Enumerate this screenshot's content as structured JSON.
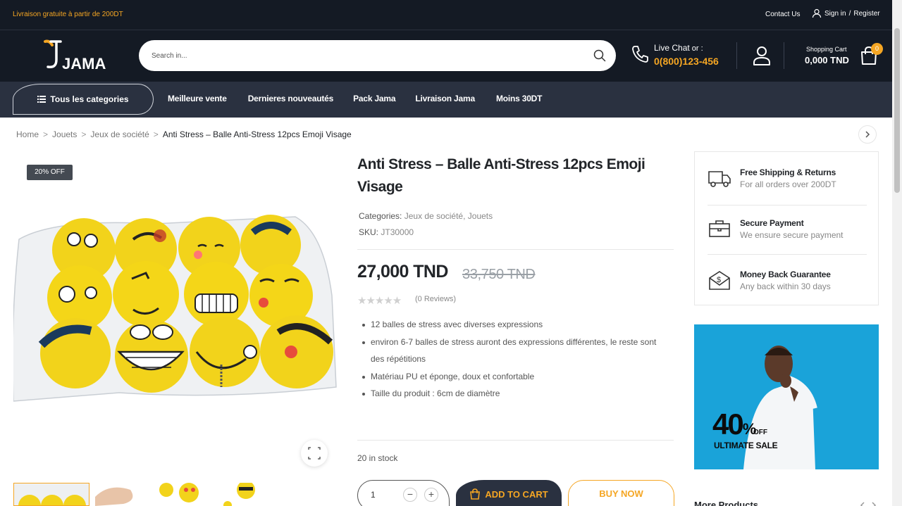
{
  "topbar": {
    "promo": "Livraison gratuite à partir de 200DT",
    "contact": "Contact Us",
    "signin": "Sign in",
    "slash": "/",
    "register": "Register"
  },
  "header": {
    "logo_text": "JAMA",
    "search_placeholder": "Search in...",
    "chat_label": "Live Chat",
    "chat_or": " or :",
    "phone": "0(800)123-456",
    "cart_label": "Shopping Cart",
    "cart_amount": "0,000 TND",
    "cart_count": "0"
  },
  "nav": {
    "categories": "Tous les categories",
    "links": [
      "Meilleure vente",
      "Dernieres nouveautés",
      "Pack Jama",
      "Livraison Jama",
      "Moins 30DT"
    ]
  },
  "breadcrumb": {
    "items": [
      "Home",
      "Jouets",
      "Jeux de société"
    ],
    "separator": ">",
    "current": "Anti Stress – Balle Anti-Stress 12pcs Emoji Visage"
  },
  "product": {
    "badge": "20% OFF",
    "title": "Anti Stress – Balle Anti-Stress 12pcs Emoji Visage",
    "categories_label": "Categories:",
    "categories": "Jeux de société, Jouets",
    "sku_label": "SKU:",
    "sku": "JT30000",
    "price": "27,000 TND",
    "old_price": "33,750 TND",
    "rating": 0,
    "reviews": "(0 Reviews)",
    "bullets": [
      "12 balles de stress avec diverses expressions",
      "environ 6-7 balles de stress auront des expressions différentes, le reste sont des répétitions",
      "Matériau PU et éponge, doux et confortable",
      "Taille du produit : 6cm de diamètre"
    ],
    "stock": "20 in stock",
    "quantity": "1",
    "minus": "−",
    "plus": "+",
    "add_to_cart": "ADD TO CART",
    "buy_now": "BUY NOW"
  },
  "sidebar": {
    "features": [
      {
        "title": "Free Shipping & Returns",
        "desc": "For all orders over 200DT",
        "icon": "truck-icon"
      },
      {
        "title": "Secure Payment",
        "desc": "We ensure secure payment",
        "icon": "briefcase-icon"
      },
      {
        "title": "Money Back Guarantee",
        "desc": "Any back within 30 days",
        "icon": "money-envelope-icon"
      }
    ],
    "banner_pct": "40",
    "banner_pct_sign": "%",
    "banner_off": "OFF",
    "banner_text": "ULTIMATE SALE",
    "more_products": "More Products"
  },
  "colors": {
    "dark": "#141a24",
    "nav": "#2a3140",
    "accent": "#f5a623",
    "banner": "#1aa3d9"
  }
}
